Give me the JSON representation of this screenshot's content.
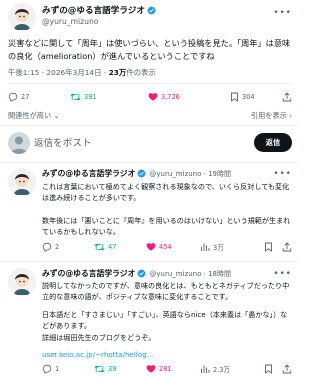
{
  "main_post": {
    "author_name": "みずの@ゆる言語学ラジオ",
    "handle": "@yuru_mizuno",
    "text": "災害などに関して「周年」は使いづらい、という投稿を見た。「周年」は意味の良化（amelioration）が進んでいるということですね",
    "time": "午後1:15 · 2026年3月14日 · ",
    "views_count": "23万",
    "views_label": "件の表示",
    "replies": "27",
    "reposts": "391",
    "likes": "3,726",
    "bookmarks": "304"
  },
  "tabs": {
    "relevant": "関連性が高い",
    "quotes": "引用を表示"
  },
  "reply_box": {
    "placeholder": "返信をポスト",
    "button": "返信"
  },
  "replies": [
    {
      "author_name": "みずの@ゆる言語学ラジオ",
      "handle_time": "@yuru_mizuno · 19時間",
      "paragraphs": [
        "これは言葉において極めてよく観察される現象なので、いくら反対しても変化は進み続けることが多いです。",
        "数年後には「悪いことに『周年』を用いるのはいけない」という規範が生まれているかもしれないな。"
      ],
      "replies": "2",
      "reposts": "47",
      "likes": "454",
      "views": "3万"
    },
    {
      "author_name": "みずの@ゆる言語学ラジオ",
      "handle_time": "@yuru_mizuno · 18時間",
      "paragraphs": [
        "説明してなかったのですが、意味の良化とは、もともとネガティブだったり中立的な意味の語が、ポジティブな意味に変化することです。",
        "日本語だと「すさまじい」「すごい」、英語ならnice（本来義は「愚かな」）などがあります。\n詳細は堀田先生のブログをどうぞ。"
      ],
      "link": "user.keio.ac.jp/~rhotta/hellog...",
      "replies": "1",
      "reposts": "39",
      "likes": "281",
      "views": "2.3万"
    }
  ],
  "colors": {
    "verified": "#1d9bf0",
    "repost_active": "#00ba7c",
    "like_active": "#f91880",
    "muted": "#536471",
    "link": "#1d9bf0"
  }
}
